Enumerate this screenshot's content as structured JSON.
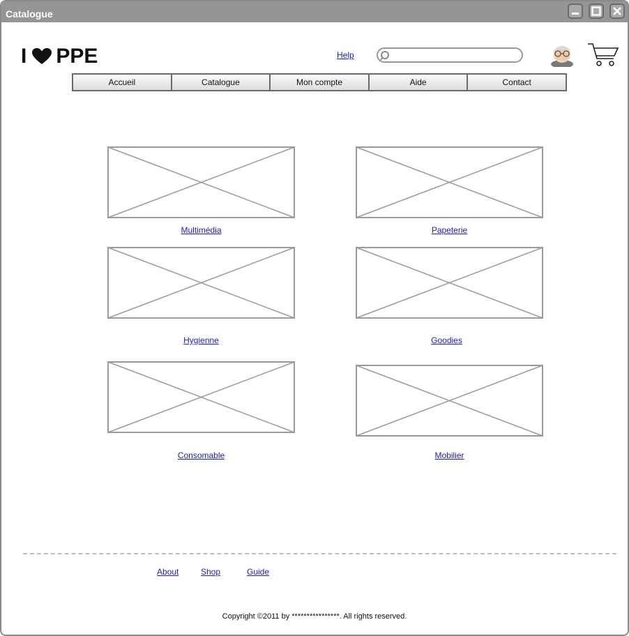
{
  "window": {
    "title": "Catalogue",
    "buttons": [
      "minimize-icon",
      "maximize-icon",
      "close-icon"
    ]
  },
  "header": {
    "logo_left": "I",
    "logo_icon": "heart-icon",
    "logo_right": "PPE",
    "help_label": "Help",
    "search": {
      "value": "",
      "placeholder": ""
    },
    "avatar_icon": "user-avatar-icon",
    "cart_icon": "shopping-cart-icon"
  },
  "nav": {
    "items": [
      {
        "label": "Accueil"
      },
      {
        "label": "Catalogue"
      },
      {
        "label": "Mon compte"
      },
      {
        "label": "Aide"
      },
      {
        "label": "Contact"
      }
    ]
  },
  "categories": [
    {
      "label": "Multimédia"
    },
    {
      "label": "Papeterie"
    },
    {
      "label": "Hygienne"
    },
    {
      "label": "Goodies "
    },
    {
      "label": "Consomable "
    },
    {
      "label": "Mobilier"
    }
  ],
  "footer": {
    "links": [
      {
        "label": "About"
      },
      {
        "label": "Shop"
      },
      {
        "label": "Guide"
      }
    ],
    "copyright": "Copyright ©2011 by ****************. All rights reserved."
  },
  "colors": {
    "titlebar": "#959595",
    "link": "#1a1ad0",
    "placeholder_stroke": "#9a9a9a",
    "nav_border": "#6a6a6a"
  }
}
